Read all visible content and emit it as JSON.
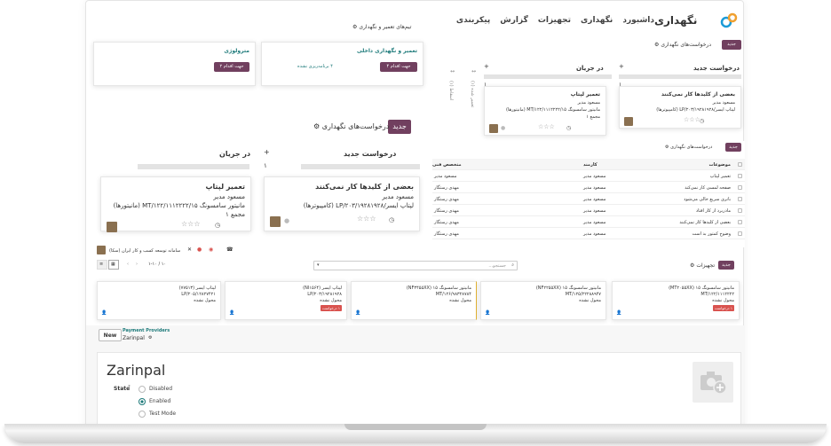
{
  "nav": {
    "brand": "نگهداری",
    "menu": [
      "داشبورد",
      "نگهداری",
      "تجهیزات",
      "گزارش",
      "پیکربندی"
    ]
  },
  "teams": {
    "breadcrumb": "تیم‌های تعمیر و نگهداری",
    "cards": [
      {
        "title": "تعمیر و نگهداری داخلی",
        "button": "۴ جهت اقدام",
        "status": "۴ برنامه‌ریزی نشده"
      },
      {
        "title": "مترولوژی",
        "button": "۲ جهت اقدام"
      }
    ]
  },
  "kanban_small": {
    "new_button": "جدید",
    "breadcrumb": "درخواست‌های نگهداری",
    "cols": [
      {
        "title": "درخواست جدید",
        "count": "۱"
      },
      {
        "title": "در جریان",
        "count": "۱"
      }
    ],
    "folded": [
      {
        "title": "تعمیر شده",
        "count": "(۱)"
      },
      {
        "title": "اسقاط",
        "count": "(۱)"
      }
    ],
    "card1": {
      "title": "بعضی از کلیدها کار نمی‌کنند",
      "line1": "مسعود مدیر",
      "line2": "لپتاپ ایسر/LP/۲۰۳/۱۹۲۸۱۹۲۸ (کامپیوترها)"
    },
    "card2": {
      "title": "تعمیر لپتاپ",
      "line1": "مسعود مدیر",
      "line2": "مانیتور سامسونگ ۱۵/MT/۱۲۲/۱۱۱۲۲۲۲ (مانیتورها)",
      "line3": "مجمع ۱"
    }
  },
  "kanban_big": {
    "new_button": "جدید",
    "breadcrumb": "درخواست‌های نگهداری",
    "cols": [
      {
        "title": "درخواست جدید",
        "count": "۱"
      },
      {
        "title": "در جریان",
        "count": "۱"
      }
    ],
    "card1": {
      "title": "بعضی از کلیدها کار نمی‌کنند",
      "line1": "مسعود مدیر",
      "line2": "لپتاپ ایسر/LP/۲۰۳/۱۹۲۸۱۹۲۸ (کامپیوترها)"
    },
    "card2": {
      "title": "تعمیر لپتاپ",
      "line1": "مسعود مدیر",
      "line2": "مانیتور سامسونگ ۱۵/MT/۱۲۲/۱۱۱۲۲۲۲ (مانیتورها)",
      "line3": "مجمع ۱"
    }
  },
  "list": {
    "new_button": "جدید",
    "breadcrumb": "درخواست‌های نگهداری",
    "headers": [
      "موضوعات",
      "کارمند",
      "متخصص فنی"
    ],
    "rows": [
      [
        "تعمیر لپتاپ",
        "مسعود مدیر",
        "مسعود مدیر"
      ],
      [
        "صفحه لمسی کار نمی‌کند",
        "مسعود مدیر",
        "مهدی رستگار"
      ],
      [
        "باتری سریع خالی می‌شود",
        "مسعود مدیر",
        "مهدی رستگار"
      ],
      [
        "مادربرد از کار افتاد",
        "مسعود مدیر",
        "مهدی رستگار"
      ],
      [
        "بعضی از کلیدها کار نمی‌کنند",
        "مسعود مدیر",
        "مهدی رستگار"
      ],
      [
        "وضوح کمتور بد است",
        "مسعود مدیر",
        "مهدی رستگار"
      ]
    ]
  },
  "equipment": {
    "new_button": "جدید",
    "breadcrumb": "تجهیزات",
    "search_placeholder": "جستجو...",
    "pager": "۱-۱۰ / ۱۰",
    "cards": [
      {
        "title": "مانیتور سامسونگ ۱۵ (MT۲۰۵۵XX)",
        "serial": "MT/۱۲۲/۱۱۱۲۲۲۲",
        "status": "محول نشده",
        "tag": "۱ درخواست"
      },
      {
        "title": "مانیتور سامسونگ ۱۵ (NF۲۲۵۵XX)",
        "serial": "MT/۱۲۵/۲۲۲۸۸۹۴۷",
        "status": "محول نشده"
      },
      {
        "title": "مانیتور سامسونگ ۱۵ (NF۳۴۵۵XX)",
        "serial": "MT/۱۲۶/۹۸۳۲۸۷۸۴",
        "status": "محول نشده"
      },
      {
        "title": "لپتاپ ایسر (NI۱۵۶۴)",
        "serial": "LP/۲۰۳/۱۹۲۸۱۹۲۸",
        "status": "محول نشده",
        "tag": "۱ درخواست"
      },
      {
        "title": "لپتاپ ایسر (۷۷۵۱۳)",
        "serial": "LP/۲۰۵/۱۲۸۲۷۴۲۱",
        "status": "محول نشده"
      }
    ]
  },
  "chat": {
    "title": "سامانه توسعه کسب و کار ایران (سکا)"
  },
  "payment": {
    "new_button": "New",
    "breadcrumb_parent": "Payment Providers",
    "breadcrumb_current": "Zarinpal",
    "title": "Zarinpal",
    "state_label": "State",
    "state_help": "?",
    "options": [
      "Disabled",
      "Enabled",
      "Test Mode"
    ]
  }
}
